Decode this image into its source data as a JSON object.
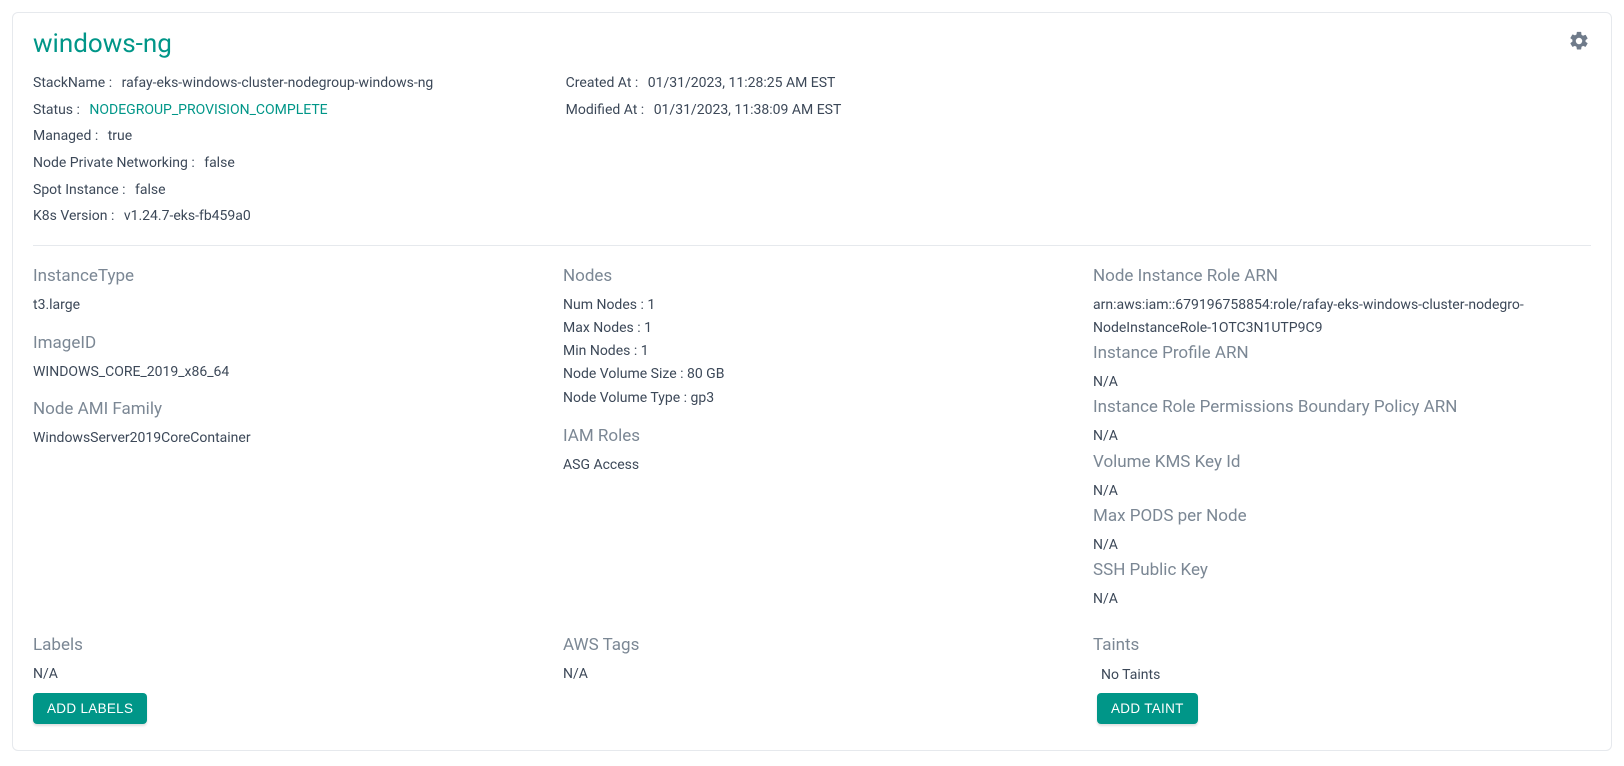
{
  "title": "windows-ng",
  "top": {
    "stackname_label": "StackName :",
    "stackname_value": "rafay-eks-windows-cluster-nodegroup-windows-ng",
    "status_label": "Status :",
    "status_value": "NODEGROUP_PROVISION_COMPLETE",
    "managed_label": "Managed :",
    "managed_value": "true",
    "npn_label": "Node Private Networking :",
    "npn_value": "false",
    "spot_label": "Spot Instance :",
    "spot_value": "false",
    "k8s_label": "K8s Version :",
    "k8s_value": "v1.24.7-eks-fb459a0",
    "created_label": "Created At :",
    "created_value": "01/31/2023, 11:28:25 AM EST",
    "modified_label": "Modified At :",
    "modified_value": "01/31/2023, 11:38:09 AM EST"
  },
  "left": {
    "instancetype_heading": "InstanceType",
    "instancetype_value": "t3.large",
    "imageid_heading": "ImageID",
    "imageid_value": "WINDOWS_CORE_2019_x86_64",
    "amifamily_heading": "Node AMI Family",
    "amifamily_value": "WindowsServer2019CoreContainer"
  },
  "mid": {
    "nodes_heading": "Nodes",
    "num_label": "Num Nodes",
    "num_value": "1",
    "max_label": "Max Nodes",
    "max_value": "1",
    "min_label": "Min Nodes",
    "min_value": "1",
    "volsize_label": "Node Volume Size",
    "volsize_value": "80 GB",
    "voltype_label": "Node Volume Type",
    "voltype_value": "gp3",
    "iam_heading": "IAM Roles",
    "iam_value": "ASG Access"
  },
  "right": {
    "nir_heading": "Node Instance Role ARN",
    "nir_value": "arn:aws:iam::679196758854:role/rafay-eks-windows-cluster-nodegro-NodeInstanceRole-1OTC3N1UTP9C9",
    "ipa_heading": "Instance Profile ARN",
    "ipa_value": "N/A",
    "irpb_heading": "Instance Role Permissions Boundary Policy ARN",
    "irpb_value": "N/A",
    "kms_heading": "Volume KMS Key Id",
    "kms_value": "N/A",
    "maxpods_heading": "Max PODS per Node",
    "maxpods_value": "N/A",
    "ssh_heading": "SSH Public Key",
    "ssh_value": "N/A"
  },
  "bottom": {
    "labels_heading": "Labels",
    "labels_value": "N/A",
    "labels_button": "ADD LABELS",
    "tags_heading": "AWS Tags",
    "tags_value": "N/A",
    "taints_heading": "Taints",
    "taints_value": "No Taints",
    "taints_button": "ADD TAINT"
  }
}
